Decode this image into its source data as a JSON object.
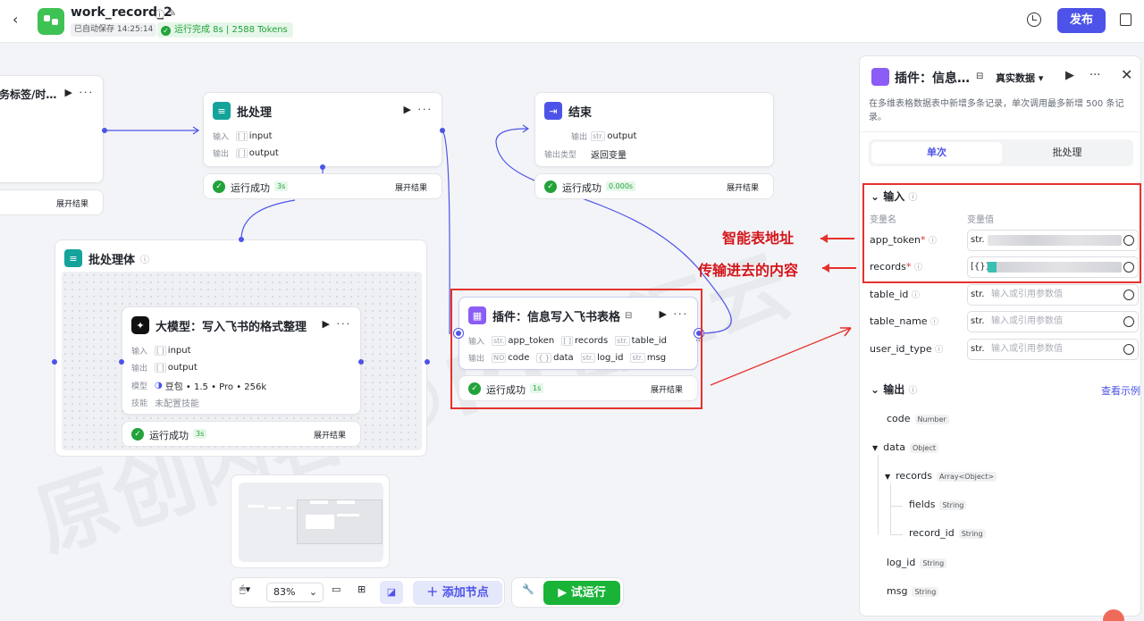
{
  "app": {
    "back": "‹",
    "title": "work_record_2",
    "autosave": "已自动保存 14:25:14",
    "run_status": "运行完成 8s | 2588 Tokens",
    "publish": "发布"
  },
  "canvas": {
    "partial_node": {
      "title": "务标签/时…",
      "expand": "展开结果"
    },
    "batch_node": {
      "title": "批处理",
      "in_label": "输入",
      "in_var": "input",
      "out_label": "输出",
      "out_var": "output",
      "status": "运行成功",
      "time": "3s",
      "expand": "展开结果"
    },
    "end_node": {
      "title": "结束",
      "out_label": "输出",
      "out_var": "output",
      "type_label": "输出类型",
      "type_value": "返回变量",
      "status": "运行成功",
      "time": "0.000s",
      "expand": "展开结果"
    },
    "batch_body": {
      "title": "批处理体"
    },
    "llm_node": {
      "title": "大模型：写入飞书的格式整理",
      "in_label": "输入",
      "in_var": "input",
      "out_label": "输出",
      "out_var": "output",
      "model_label": "模型",
      "model_value": "豆包 • 1.5 • Pro • 256k",
      "skill_label": "技能",
      "skill_value": "未配置技能",
      "status": "运行成功",
      "time": "3s",
      "expand": "展开结果"
    },
    "plugin_node": {
      "title": "插件：信息写入飞书表格",
      "in_label": "输入",
      "inputs": [
        "app_token",
        "records",
        "table_id"
      ],
      "out_label": "输出",
      "outputs": [
        "code",
        "data",
        "log_id",
        "msg"
      ],
      "status": "运行成功",
      "time": "1s",
      "expand": "展开结果"
    },
    "toolbar": {
      "zoom": "83%",
      "add_node": "添加节点",
      "trial_run": "试运行"
    }
  },
  "annotations": {
    "a1": "智能表地址",
    "a2": "传输进去的内容",
    "watermark": "原创内容 ©PT智汇云"
  },
  "panel": {
    "title": "插件：信息…",
    "data_mode": "真实数据 ▾",
    "description": "在多维表格数据表中新增多条记录，单次调用最多新增 500 条记录。",
    "tab_single": "单次",
    "tab_batch": "批处理",
    "input_section": "输入",
    "col_name": "变量名",
    "col_value": "变量值",
    "placeholder": "输入或引用参数值",
    "fields": [
      {
        "name": "app_token",
        "required": "*",
        "type": "str."
      },
      {
        "name": "records",
        "required": "*",
        "type": "[{}]"
      },
      {
        "name": "table_id",
        "required": "",
        "type": "str."
      },
      {
        "name": "table_name",
        "required": "",
        "type": "str."
      },
      {
        "name": "user_id_type",
        "required": "",
        "type": "str."
      }
    ],
    "output_section": "输出",
    "see_example": "查看示例",
    "outputs": [
      {
        "name": "code",
        "type": "Number"
      },
      {
        "name": "data",
        "type": "Object"
      },
      {
        "name": "records",
        "type": "Array<Object>"
      },
      {
        "name": "fields",
        "type": "String"
      },
      {
        "name": "record_id",
        "type": "String"
      },
      {
        "name": "log_id",
        "type": "String"
      },
      {
        "name": "msg",
        "type": "String"
      }
    ]
  }
}
